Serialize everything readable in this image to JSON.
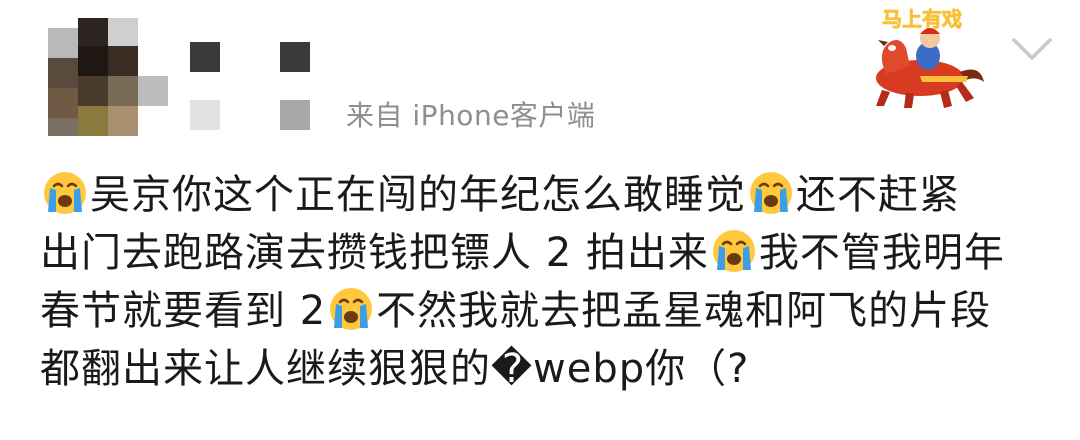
{
  "post": {
    "source_label": "来自 iPhone客户端",
    "sticker": {
      "icon": "horse-rider-sticker-icon",
      "caption": "马上有戏"
    },
    "chevron_icon": "chevron-down-icon",
    "emoji_icon": "crying-face-emoji-icon",
    "lines": [
      {
        "segments": [
          {
            "type": "emoji"
          },
          {
            "type": "text",
            "value": "吴京你这个正在闯的年纪怎么敢睡觉"
          },
          {
            "type": "emoji"
          },
          {
            "type": "text",
            "value": "还不赶紧"
          }
        ]
      },
      {
        "segments": [
          {
            "type": "text",
            "value": "出门去跑路演去攒钱把镖人 2 拍出来"
          },
          {
            "type": "emoji"
          },
          {
            "type": "text",
            "value": "我不管我明年"
          }
        ]
      },
      {
        "segments": [
          {
            "type": "text",
            "value": "春节就要看到 2"
          },
          {
            "type": "emoji"
          },
          {
            "type": "text",
            "value": "不然我就去把孟星魂和阿飞的片段"
          }
        ]
      },
      {
        "segments": [
          {
            "type": "text",
            "value": "都翻出来让人继续狠狠的�webp你（?"
          }
        ]
      }
    ]
  },
  "colors": {
    "text": "#1a1a1a",
    "source_text": "#8e8e93",
    "chevron": "#c7c7cc",
    "emoji_face": "#ffc83d",
    "emoji_tears": "#3b9fe8"
  }
}
